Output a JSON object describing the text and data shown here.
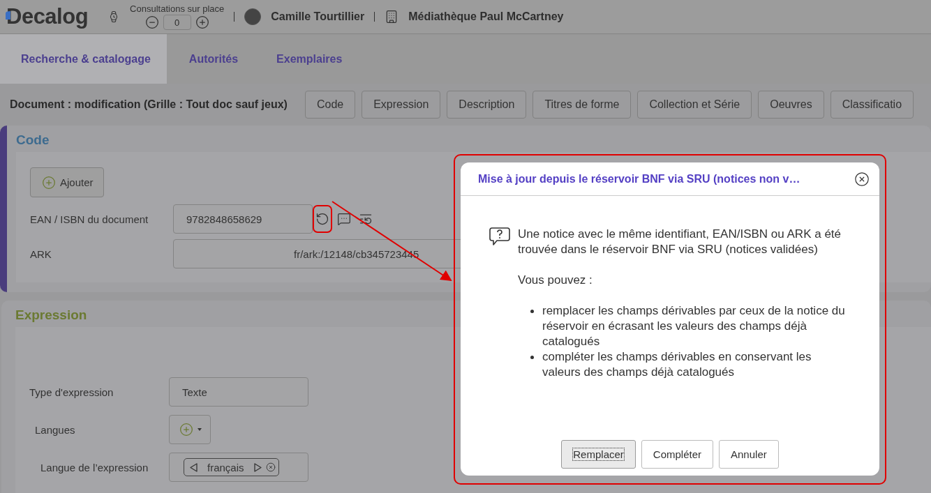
{
  "header": {
    "logo": "Decalog",
    "counter": {
      "label": "Consultations sur place",
      "value": "0"
    },
    "user": {
      "name": "Camille Tourtillier"
    },
    "library": {
      "name": "Médiathèque Paul McCartney"
    }
  },
  "tabs": [
    {
      "label": "Recherche & catalogage",
      "selected": true
    },
    {
      "label": "Autorités",
      "selected": false
    },
    {
      "label": "Exemplaires",
      "selected": false
    }
  ],
  "document": {
    "title": "Document : modification (Grille : Tout doc sauf jeux)",
    "section_buttons": [
      "Code",
      "Expression",
      "Description",
      "Titres de forme",
      "Collection et Série",
      "Oeuvres",
      "Classificatio"
    ]
  },
  "code_section": {
    "title": "Code",
    "add_button": "Ajouter",
    "fields": [
      {
        "label": "EAN / ISBN du document",
        "value": "9782848658629",
        "actions": [
          {
            "kind": "refresh",
            "annotated": true
          },
          {
            "kind": "chat",
            "annotated": false
          },
          {
            "kind": "reset",
            "annotated": false
          }
        ]
      },
      {
        "label": "ARK",
        "value": "fr/ark:/12148/cb345723445"
      }
    ]
  },
  "expression_section": {
    "title": "Expression",
    "fields": [
      {
        "label": "Type d'expression",
        "kind": "text",
        "value": "Texte"
      },
      {
        "label": "Langues",
        "kind": "add-menu"
      },
      {
        "label": "Langue de l’expression",
        "kind": "chips",
        "chips": [
          "français"
        ]
      }
    ]
  },
  "dialog": {
    "title": "Mise à jour depuis le réservoir BNF via SRU (notices non v…",
    "annotated": true,
    "message": "Une notice avec le même identifiant, EAN/ISBN ou ARK a été trouvée dans le réservoir BNF via SRU (notices validées)",
    "prompt": "Vous pouvez :",
    "options": [
      "remplacer les champs dérivables par ceux de la notice du réservoir en écrasant les valeurs des champs déjà catalogués",
      "compléter les champs dérivables en conservant les valeurs des champs déjà catalogués"
    ],
    "buttons": [
      {
        "label": "Remplacer",
        "focused": true
      },
      {
        "label": "Compléter",
        "focused": false
      },
      {
        "label": "Annuler",
        "focused": false
      }
    ]
  }
}
